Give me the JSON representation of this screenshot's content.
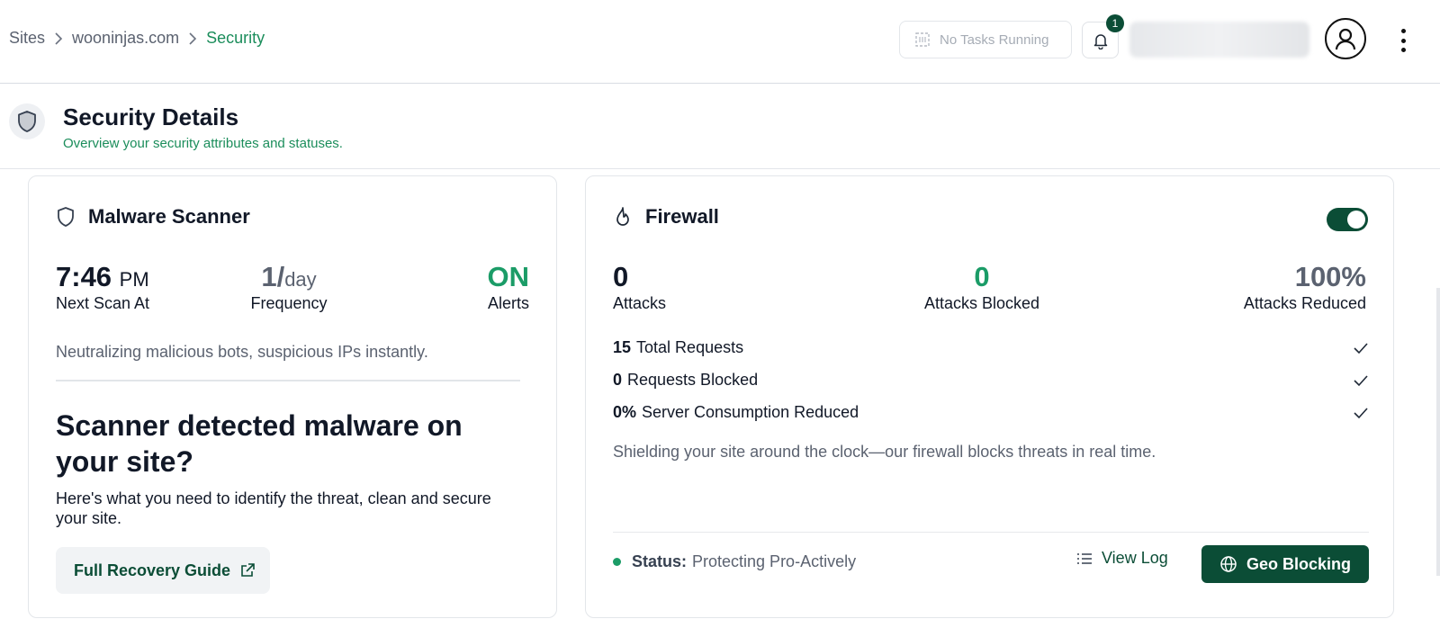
{
  "breadcrumb": {
    "items": [
      "Sites",
      "wooninjas.com",
      "Security"
    ]
  },
  "topbar": {
    "tasks_label": "No Tasks Running",
    "notification_count": "1"
  },
  "header": {
    "title": "Security Details",
    "subtitle": "Overview your security attributes and statuses."
  },
  "malware": {
    "title": "Malware Scanner",
    "next_scan_time": "7:46",
    "next_scan_ampm": "PM",
    "next_scan_label": "Next Scan At",
    "frequency_value": "1/",
    "frequency_unit": "day",
    "frequency_label": "Frequency",
    "alerts_value": "ON",
    "alerts_label": "Alerts",
    "description": "Neutralizing malicious bots, suspicious IPs instantly.",
    "question": "Scanner detected malware on your site?",
    "help_text": "Here's what you need to identify the threat, clean and secure your site.",
    "guide_button": "Full Recovery Guide"
  },
  "firewall": {
    "title": "Firewall",
    "enabled": true,
    "attacks_value": "0",
    "attacks_label": "Attacks",
    "blocked_value": "0",
    "blocked_label": "Attacks Blocked",
    "reduced_value": "100%",
    "reduced_label": "Attacks Reduced",
    "rows": [
      {
        "value": "15",
        "label": "Total Requests"
      },
      {
        "value": "0",
        "label": "Requests Blocked"
      },
      {
        "value": "0%",
        "label": "Server Consumption Reduced"
      }
    ],
    "description": "Shielding your site around the clock—our firewall blocks threats in real time.",
    "status_label": "Status:",
    "status_value": "Protecting Pro-Actively",
    "view_log": "View Log",
    "geo_button": "Geo Blocking"
  },
  "colors": {
    "brand_dark": "#0b4d36",
    "brand_green": "#1b9c67"
  }
}
